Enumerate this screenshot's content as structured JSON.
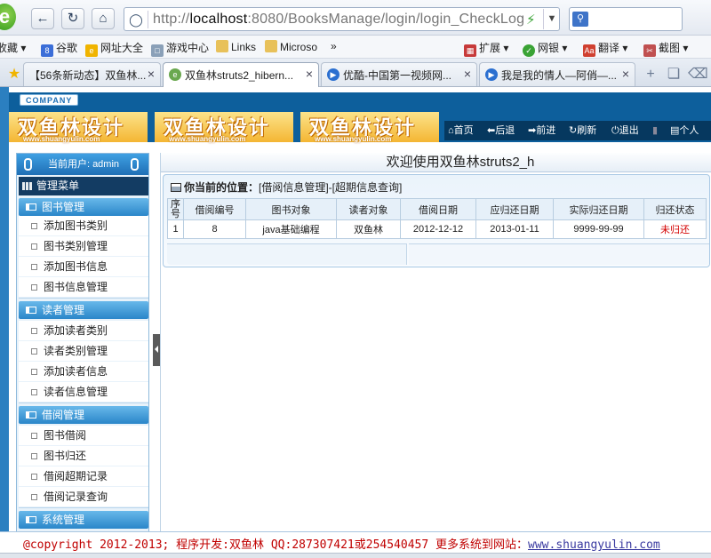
{
  "browser": {
    "back_icon": "back-arrow-icon",
    "url_prefix": "http://",
    "url_host": "localhost",
    "url_rest": ":8080/BooksManage/login/login_CheckLog"
  },
  "bookmarks": [
    {
      "label": "收藏",
      "icon": "star-icon"
    },
    {
      "label": "谷歌",
      "icon": "google-icon"
    },
    {
      "label": "网址大全",
      "icon": "sites-icon"
    },
    {
      "label": "游戏中心",
      "icon": "game-icon"
    },
    {
      "label": "Links",
      "icon": "folder-icon"
    },
    {
      "label": "Microso",
      "icon": "folder-icon"
    },
    {
      "label": "»",
      "icon": "more-icon"
    },
    {
      "label": "扩展",
      "icon": "extension-icon"
    },
    {
      "label": "网银",
      "icon": "bank-icon"
    },
    {
      "label": "翻译",
      "icon": "translate-icon"
    },
    {
      "label": "截图",
      "icon": "screenshot-icon"
    }
  ],
  "tabs": [
    {
      "label": "【56条新动态】双鱼林..."
    },
    {
      "label": "双鱼林struts2_hibern..."
    },
    {
      "label": "优酷-中国第一视频网..."
    },
    {
      "label": "我是我的情人—阿俏—..."
    }
  ],
  "site": {
    "company": "COMPANY",
    "banner_text": "双鱼林设计",
    "banner_url": "www.shuangyulin.com",
    "nav": [
      "首页",
      "后退",
      "前进",
      "刷新",
      "退出",
      "个人"
    ]
  },
  "sidebar": {
    "current_user": "当前用户: admin",
    "menu_title": "管理菜单",
    "groups": [
      {
        "title": "图书管理",
        "items": [
          "添加图书类别",
          "图书类别管理",
          "添加图书信息",
          "图书信息管理"
        ]
      },
      {
        "title": "读者管理",
        "items": [
          "添加读者类别",
          "读者类别管理",
          "添加读者信息",
          "读者信息管理"
        ]
      },
      {
        "title": "借阅管理",
        "items": [
          "图书借阅",
          "图书归还",
          "借阅超期记录",
          "借阅记录查询"
        ]
      },
      {
        "title": "系统管理",
        "items": []
      }
    ]
  },
  "main": {
    "welcome": "欢迎使用双鱼林struts2_h",
    "location_label": "你当前的位置：",
    "location_path": "[借阅信息管理]-[超期信息查询]",
    "columns": [
      "序号",
      "借阅编号",
      "图书对象",
      "读者对象",
      "借阅日期",
      "应归还日期",
      "实际归还日期",
      "归还状态"
    ],
    "rows": [
      [
        "1",
        "8",
        "java基础编程",
        "双鱼林",
        "2012-12-12",
        "2013-01-11",
        "9999-99-99",
        "未归还"
      ]
    ],
    "status_color": "#d40000"
  },
  "footer": {
    "text": "@copyright 2012-2013; 程序开发:双鱼林  QQ:287307421或254540457  更多系统到网站：",
    "link": "www.shuangyulin.com"
  }
}
